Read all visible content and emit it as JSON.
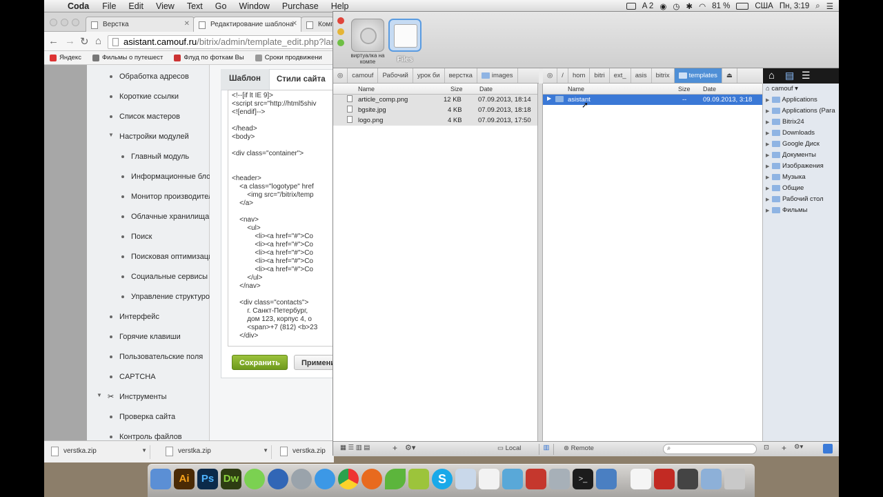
{
  "menubar": {
    "app": "Coda",
    "items": [
      "File",
      "Edit",
      "View",
      "Text",
      "Go",
      "Window",
      "Purchase",
      "Help"
    ],
    "status": {
      "a2": "A 2",
      "battery": "81 %",
      "locale": "США",
      "clock": "Пн, 3:19"
    }
  },
  "browser": {
    "tabs": [
      {
        "title": "Верстка"
      },
      {
        "title": "Редактирование шаблона"
      },
      {
        "title": "Комп"
      }
    ],
    "url": {
      "host": "asistant.camouf.ru",
      "path": "/bitrix/admin/template_edit.php?lan"
    },
    "bookmarks": [
      {
        "label": "Яндекс",
        "color": "#d33"
      },
      {
        "label": "Фильмы о путешест",
        "color": "#777"
      },
      {
        "label": "Флуд по фоткам Вы",
        "color": "#c33"
      },
      {
        "label": "Сроки продвижени",
        "color": "#999"
      }
    ],
    "menu": [
      {
        "label": "Обработка адресов",
        "level": 1
      },
      {
        "label": "Короткие ссылки",
        "level": 1
      },
      {
        "label": "Список мастеров",
        "level": 1
      },
      {
        "label": "Настройки модулей",
        "level": 1,
        "expanded": true
      },
      {
        "label": "Главный модуль",
        "level": 2
      },
      {
        "label": "Информационные блок",
        "level": 2
      },
      {
        "label": "Монитор производител",
        "level": 2
      },
      {
        "label": "Облачные хранилища",
        "level": 2
      },
      {
        "label": "Поиск",
        "level": 2
      },
      {
        "label": "Поисковая оптимизаци",
        "level": 2
      },
      {
        "label": "Социальные сервисы",
        "level": 2
      },
      {
        "label": "Управление структуро",
        "level": 2
      },
      {
        "label": "Интерфейс",
        "level": 1
      },
      {
        "label": "Горячие клавиши",
        "level": 1
      },
      {
        "label": "Пользовательские поля",
        "level": 1
      },
      {
        "label": "CAPTCHA",
        "level": 1
      },
      {
        "label": "Инструменты",
        "level": 0,
        "expanded": true
      },
      {
        "label": "Проверка сайта",
        "level": 1
      },
      {
        "label": "Контроль файлов",
        "level": 1
      }
    ],
    "tabs_panel": {
      "template": "Шаблон",
      "styles": "Стили сайта"
    },
    "code": "<!--[if lt IE 9]>\n<script src=\"http://html5shiv\n<![endif]-->\n\n</head>\n<body>\n\n<div class=\"container\">\n\n\n<header>\n    <a class=\"logotype\" href\n        <img src=\"/bitrix/temp\n    </a>\n\n    <nav>\n        <ul>\n            <li><a href=\"#\">Co\n            <li><a href=\"#\">Co\n            <li><a href=\"#\">Co\n            <li><a href=\"#\">Co\n            <li><a href=\"#\">Co\n        </ul>\n    </nav>\n\n    <div class=\"contacts\">\n        г. Санкт-Петербург,\n        дом 123, корпус 4, о\n        <span>+7 (812) <b>23\n    </div>",
    "save": "Сохранить",
    "apply": "Примени",
    "downloads": [
      "verstka.zip",
      "verstka.zip",
      "verstka.zip"
    ]
  },
  "coda": {
    "sites": [
      {
        "label": "виртуалка на компе"
      },
      {
        "label": "Files"
      }
    ],
    "local": {
      "crumbs": [
        "camouf",
        "Рабочий",
        "урок би",
        "верстка",
        "images"
      ],
      "columns": {
        "name": "Name",
        "size": "Size",
        "date": "Date"
      },
      "files": [
        {
          "name": "article_comp.png",
          "size": "12 KB",
          "date": "07.09.2013, 18:14"
        },
        {
          "name": "bgsite.jpg",
          "size": "4 KB",
          "date": "07.09.2013, 18:18"
        },
        {
          "name": "logo.png",
          "size": "4 KB",
          "date": "07.09.2013, 17:50"
        }
      ]
    },
    "remote": {
      "crumbs": [
        "/",
        "hom",
        "bitri",
        "ext_",
        "asis",
        "bitrix",
        "templates"
      ],
      "columns": {
        "name": "Name",
        "size": "Size",
        "date": "Date"
      },
      "files": [
        {
          "name": "asistant",
          "size": "--",
          "date": "09.09.2013, 3:18"
        }
      ]
    },
    "sidebar": {
      "root": "camouf",
      "items": [
        "Applications",
        "Applications (Para",
        "Bitrix24",
        "Downloads",
        "Google Диск",
        "Документы",
        "Изображения",
        "Музыка",
        "Общие",
        "Рабочий стол",
        "Фильмы"
      ]
    },
    "bottom": {
      "local": "Local",
      "remote": "Remote"
    }
  },
  "dock": {
    "apps": [
      "Finder",
      "Illustrator",
      "Photoshop",
      "Dreamweaver",
      "Messages",
      "QuickTime",
      "Rocket",
      "Safari",
      "Chrome",
      "Firefox",
      "Leaf",
      "Android",
      "Skype",
      "Preview",
      "TextEdit",
      "Photo",
      "Parallels",
      "Tools",
      "Terminal",
      "Sync",
      "Document",
      "Acrobat",
      "Camera",
      "Folder",
      "Trash"
    ]
  }
}
